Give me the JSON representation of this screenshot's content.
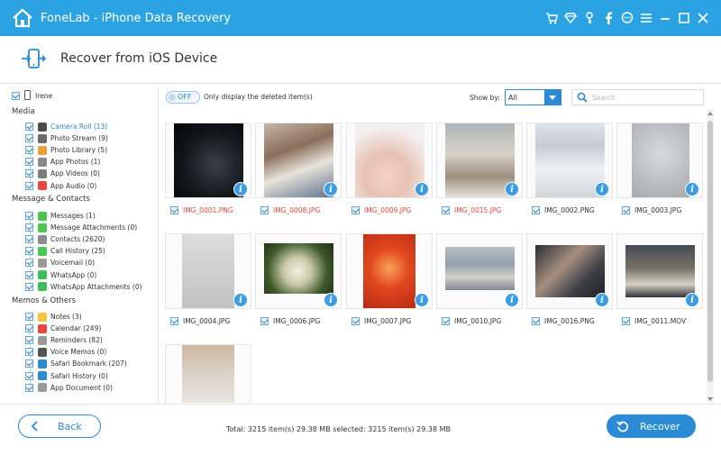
{
  "app": {
    "title": "FoneLab - iPhone Data Recovery"
  },
  "header": {
    "title": "Recover from iOS Device"
  },
  "device": {
    "name": "Irene"
  },
  "sidebar": {
    "sections": [
      {
        "title": "Media",
        "items": [
          {
            "label": "Camera Roll (13)",
            "icon": "camera-roll-icon",
            "color": "#4d4d4d"
          },
          {
            "label": "Photo Stream (9)",
            "icon": "photo-stream-icon",
            "color": "#6b6b6b"
          },
          {
            "label": "Photo Library (5)",
            "icon": "photo-library-icon",
            "color": "#e8a23b"
          },
          {
            "label": "App Photos (1)",
            "icon": "app-photos-icon",
            "color": "#8a8a8a"
          },
          {
            "label": "App Videos (0)",
            "icon": "app-videos-icon",
            "color": "#7c7c7c"
          },
          {
            "label": "App Audio (0)",
            "icon": "app-audio-icon",
            "color": "#e8473d"
          }
        ]
      },
      {
        "title": "Message & Contacts",
        "items": [
          {
            "label": "Messages (1)",
            "icon": "messages-icon",
            "color": "#4cc552"
          },
          {
            "label": "Message Attachments (0)",
            "icon": "message-attachments-icon",
            "color": "#4cc552"
          },
          {
            "label": "Contacts (2620)",
            "icon": "contacts-icon",
            "color": "#8c8c8c"
          },
          {
            "label": "Call History (25)",
            "icon": "call-history-icon",
            "color": "#4cc552"
          },
          {
            "label": "Voicemail (0)",
            "icon": "voicemail-icon",
            "color": "#9a9a9a"
          },
          {
            "label": "WhatsApp (0)",
            "icon": "whatsapp-icon",
            "color": "#3fbd5b"
          },
          {
            "label": "WhatsApp Attachments (0)",
            "icon": "whatsapp-attachments-icon",
            "color": "#3fbd5b"
          }
        ]
      },
      {
        "title": "Memos & Others",
        "items": [
          {
            "label": "Notes (3)",
            "icon": "notes-icon",
            "color": "#f2c440"
          },
          {
            "label": "Calendar (249)",
            "icon": "calendar-icon",
            "color": "#e8473d"
          },
          {
            "label": "Reminders (82)",
            "icon": "reminders-icon",
            "color": "#9a9a9a"
          },
          {
            "label": "Voice Memos (0)",
            "icon": "voice-memos-icon",
            "color": "#555555"
          },
          {
            "label": "Safari Bookmark (207)",
            "icon": "safari-bookmark-icon",
            "color": "#2b8bd5"
          },
          {
            "label": "Safari History (0)",
            "icon": "safari-history-icon",
            "color": "#2b8bd5"
          },
          {
            "label": "App Document (0)",
            "icon": "app-document-icon",
            "color": "#9a9a9a"
          }
        ]
      }
    ]
  },
  "toolbar": {
    "toggle_label": "OFF",
    "only_deleted_label": "Only display the deleted item(s)",
    "show_by_label": "Show by:",
    "show_by_value": "All",
    "search_placeholder": "Search"
  },
  "files": [
    {
      "name": "IMG_0001.PNG",
      "deleted": true
    },
    {
      "name": "IMG_0008.JPG",
      "deleted": true
    },
    {
      "name": "IMG_0009.JPG",
      "deleted": true
    },
    {
      "name": "IMG_0015.JPG",
      "deleted": true
    },
    {
      "name": "IMG_0002.PNG",
      "deleted": false
    },
    {
      "name": "IMG_0003.JPG",
      "deleted": false
    },
    {
      "name": "IMG_0004.JPG",
      "deleted": false
    },
    {
      "name": "IMG_0006.JPG",
      "deleted": false
    },
    {
      "name": "IMG_0007.JPG",
      "deleted": false
    },
    {
      "name": "IMG_0010.JPG",
      "deleted": false
    },
    {
      "name": "IMG_0016.PNG",
      "deleted": false
    },
    {
      "name": "IMG_0011.MOV",
      "deleted": false
    },
    {
      "name": "",
      "deleted": false
    }
  ],
  "footer": {
    "back_label": "Back",
    "totals_text": "Total: 3215 item(s) 29.38 MB   selected: 3215 item(s) 29.38 MB",
    "recover_label": "Recover"
  },
  "colors": {
    "accent": "#2b8bd5",
    "titlebar": "#2ba3e2",
    "deleted": "#e8473d"
  }
}
